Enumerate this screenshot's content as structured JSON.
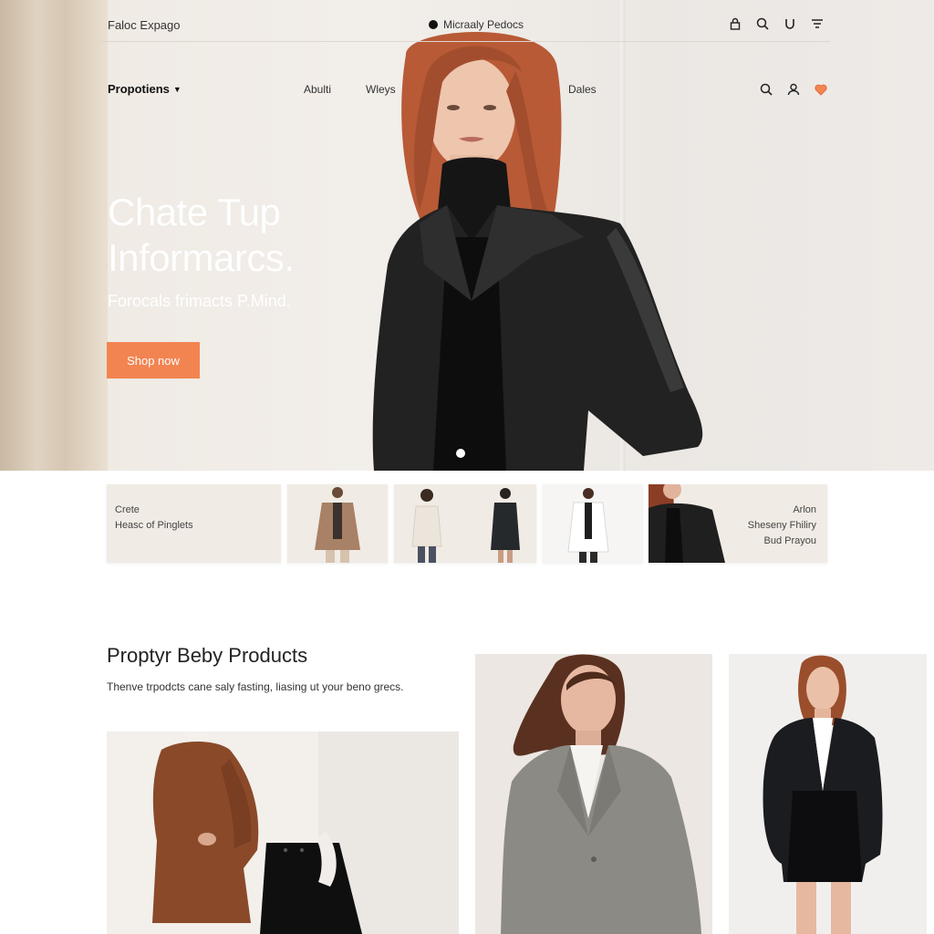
{
  "header": {
    "brand": "Faloc Expago",
    "center_brand": "Micraaly Pedocs"
  },
  "nav": {
    "dropdown_label": "Propotiens",
    "links": [
      "Abulti",
      "Wleys",
      "Dales"
    ]
  },
  "hero": {
    "title_line1": "Chate Tup",
    "title_line2": "Informarcs.",
    "subtitle": "Forocals frimacts P.Mind.",
    "cta_label": "Shop now"
  },
  "categories": {
    "left_line1": "Crete",
    "left_line2": "Heasc of Pinglets",
    "right_line1": "Arlon",
    "right_line2": "Sheseny Fhiliry",
    "right_line3": "Bud Prayou"
  },
  "products": {
    "heading": "Proptyr Beby Products",
    "description": "Thenve trpodcts cane saly fasting, liasing ut your beno grecs."
  },
  "colors": {
    "accent": "#f28452",
    "hero_bg": "#efe9e2",
    "tile_bg": "#f0ebe5"
  },
  "icons": {
    "top": [
      "lock-icon",
      "search-icon",
      "magnet-icon",
      "filter-icon"
    ],
    "nav": [
      "search-icon",
      "user-icon",
      "heart-icon"
    ]
  }
}
